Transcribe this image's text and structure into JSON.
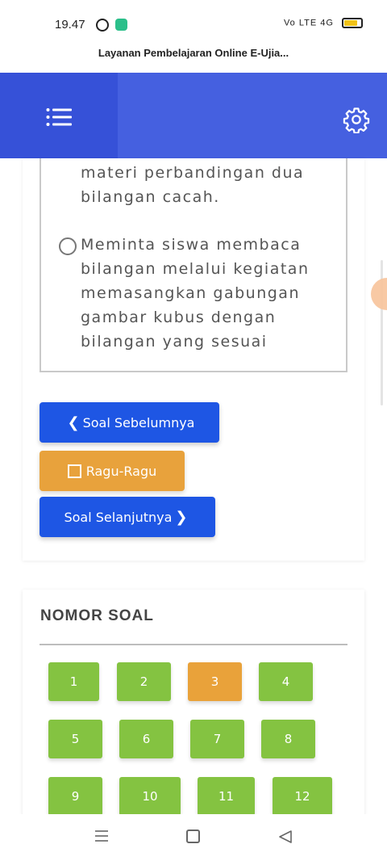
{
  "status_bar": {
    "time": "19.47",
    "network": "Vo LTE 4G"
  },
  "page": {
    "title": "Layanan Pembelajaran Online E-Ujia..."
  },
  "header": {
    "menu_icon": "list-menu-icon",
    "settings_icon": "gear-icon"
  },
  "question": {
    "previous_option_tail": "materi perbandingan dua\nbilangan cacah.",
    "option_e": "Meminta siswa membaca\nbilangan melalui kegiatan\nmemasangkan gabungan\ngambar kubus dengan\nbilangan yang sesuai"
  },
  "actions": {
    "prev_label": "Soal Sebelumnya",
    "doubt_label": "Ragu-Ragu",
    "next_label": "Soal Selanjutnya"
  },
  "nomor_soal": {
    "heading": "NOMOR SOAL",
    "numbers": [
      "1",
      "2",
      "3",
      "4",
      "5",
      "6",
      "7",
      "8",
      "9",
      "10",
      "11",
      "12"
    ],
    "active_number": "3"
  },
  "colors": {
    "header": "#4560e0",
    "primary_button": "#1e56e4",
    "doubt_button": "#e8a23c",
    "answered": "#84c341",
    "current": "#e9a23a"
  }
}
